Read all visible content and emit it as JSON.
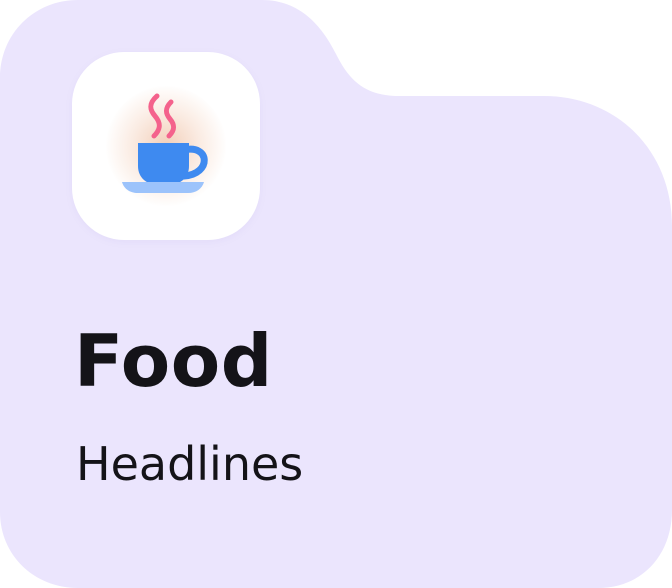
{
  "card": {
    "title": "Food",
    "subtitle": "Headlines",
    "icon": "coffee-cup-icon"
  },
  "colors": {
    "card_background": "#ebe5fd",
    "icon_tile": "#ffffff",
    "cup": "#3e8af0",
    "saucer": "#9cc3fb",
    "steam": "#f4628c",
    "text": "#141318"
  }
}
